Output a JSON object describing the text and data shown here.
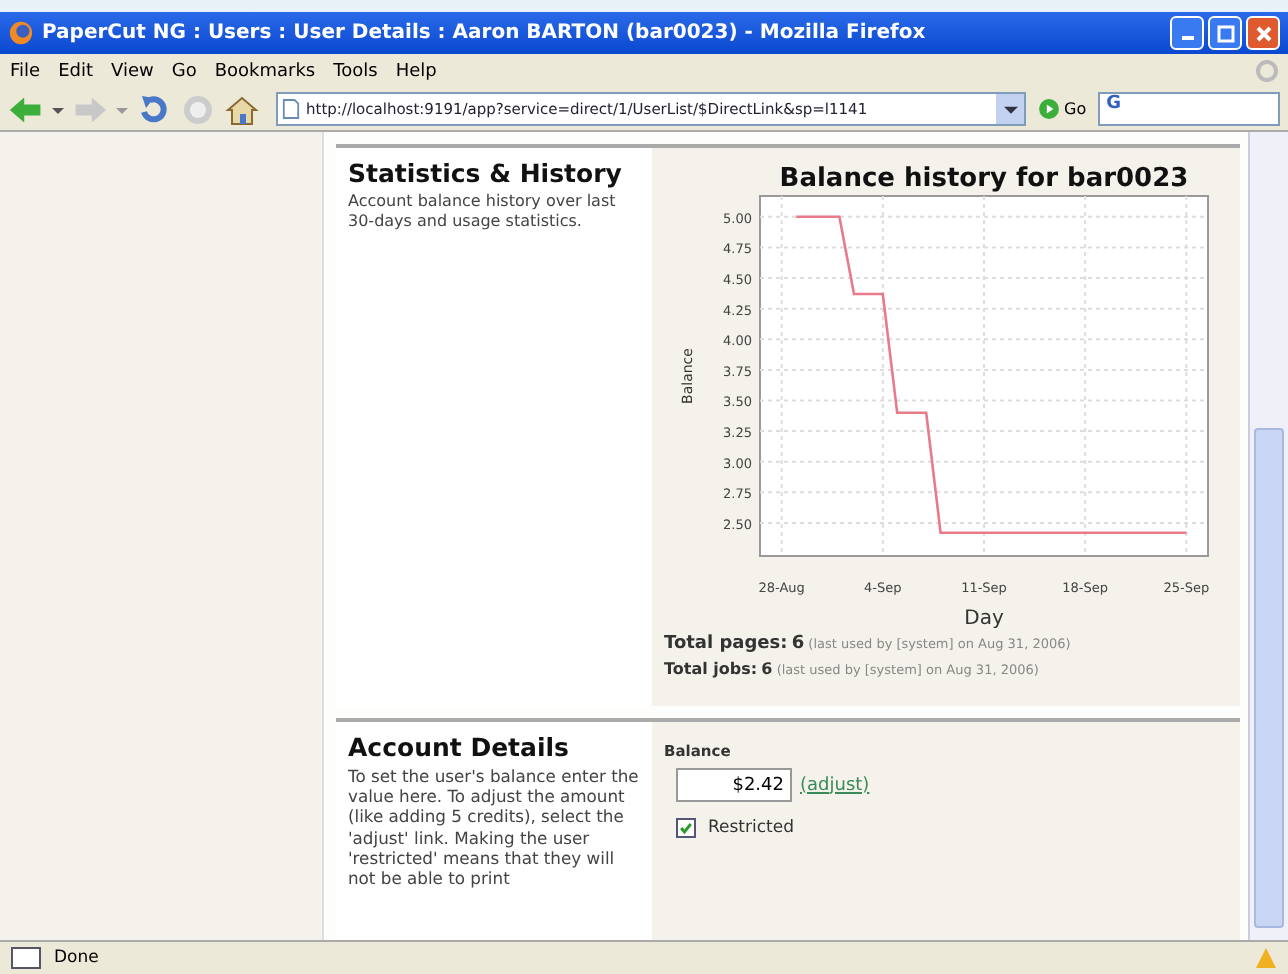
{
  "window": {
    "title": "PaperCut NG : Users : User Details : Aaron BARTON (bar0023) - Mozilla Firefox"
  },
  "menu": [
    "File",
    "Edit",
    "View",
    "Go",
    "Bookmarks",
    "Tools",
    "Help"
  ],
  "toolbar": {
    "address": "http://localhost:9191/app?service=direct/1/UserList/$DirectLink&sp=l1141",
    "go_label": "Go",
    "search_label": "G"
  },
  "statistics": {
    "heading": "Statistics & History",
    "description": "Account balance history over last 30-days and usage statistics.",
    "chart_data": {
      "type": "line",
      "title": "Balance history for bar0023",
      "xlabel": "Day",
      "ylabel": "Balance",
      "categories": [
        "28-Aug",
        null,
        null,
        null,
        null,
        null,
        null,
        "4-Sep",
        null,
        null,
        null,
        null,
        null,
        null,
        "11-Sep",
        null,
        null,
        null,
        null,
        null,
        null,
        "18-Sep",
        null,
        null,
        null,
        null,
        null,
        null,
        "25-Sep"
      ],
      "series": [
        {
          "color": "#e87a8a",
          "values": [
            null,
            5.0,
            5.0,
            5.0,
            5.0,
            4.37,
            4.37,
            4.37,
            3.4,
            3.4,
            3.4,
            2.42,
            2.42,
            2.42,
            2.42,
            2.42,
            2.42,
            2.42,
            2.42,
            2.42,
            2.42,
            2.42,
            2.42,
            2.42,
            2.42,
            2.42,
            2.42,
            2.42,
            2.42
          ]
        }
      ],
      "ylim": [
        2.23,
        5.17
      ],
      "grid": true,
      "yticks": [
        {
          "value": 2.5,
          "label": "2.50"
        },
        {
          "value": 2.75,
          "label": "2.75"
        },
        {
          "value": 3,
          "label": "3.00"
        },
        {
          "value": 3.25,
          "label": "3.25"
        },
        {
          "value": 3.5,
          "label": "3.50"
        },
        {
          "value": 3.75,
          "label": "3.75"
        },
        {
          "value": 4,
          "label": "4.00"
        },
        {
          "value": 4.25,
          "label": "4.25"
        },
        {
          "value": 4.5,
          "label": "4.50"
        },
        {
          "value": 4.75,
          "label": "4.75"
        },
        {
          "value": 5,
          "label": "5.00"
        }
      ]
    },
    "totals": [
      {
        "label": "Total pages:",
        "value": "6",
        "note": "(last used by [system] on Aug 31, 2006)"
      },
      {
        "label": "Total jobs:",
        "value": "6",
        "note": "(last used by [system] on Aug 31, 2006)"
      }
    ]
  },
  "account": {
    "heading": "Account Details",
    "description": "To set the user's balance enter the value here. To adjust the amount (like adding 5 credits), select the 'adjust' link. Making the user 'restricted' means that they will not be able to print",
    "balance_label": "Balance",
    "balance_value": "$2.42",
    "adjust_link": "(adjust)",
    "restricted": {
      "label": "Restricted",
      "checked": true
    }
  },
  "status_bar": "Done"
}
